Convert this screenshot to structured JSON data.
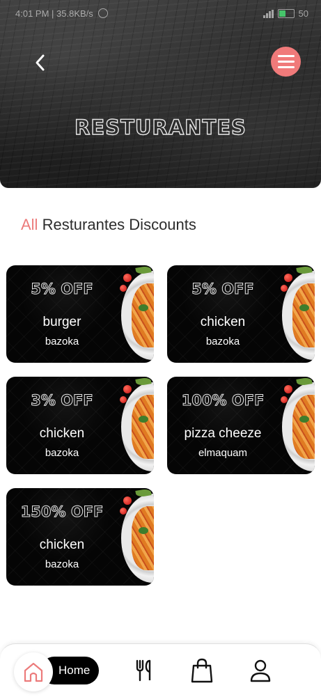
{
  "status_bar": {
    "time_text": "4:01 PM | 35.8KB/s",
    "battery_text": "50"
  },
  "header": {
    "title": "RESTURANTES",
    "background_color": "#2a2a2a",
    "menu_button_color": "#f07a7a",
    "back_icon": "chevron-left-icon",
    "menu_icon": "menu-icon"
  },
  "section": {
    "accent_word": "All",
    "title_rest": " Resturantes Discounts",
    "accent_color": "#ec7b7b"
  },
  "cards": [
    {
      "discount": "5% OFF",
      "name": "burger",
      "subtitle": "bazoka"
    },
    {
      "discount": "5% OFF",
      "name": "chicken",
      "subtitle": "bazoka"
    },
    {
      "discount": "3% OFF",
      "name": "chicken",
      "subtitle": "bazoka"
    },
    {
      "discount": "100% OFF",
      "name": "pizza cheeze",
      "subtitle": "elmaquam"
    },
    {
      "discount": "150% OFF",
      "name": "chicken",
      "subtitle": "bazoka"
    }
  ],
  "bottom_nav": {
    "home_label": "Home",
    "active_color": "#ec7b7b",
    "icons": [
      "home-icon",
      "utensils-icon",
      "shopping-bag-icon",
      "profile-icon"
    ]
  }
}
